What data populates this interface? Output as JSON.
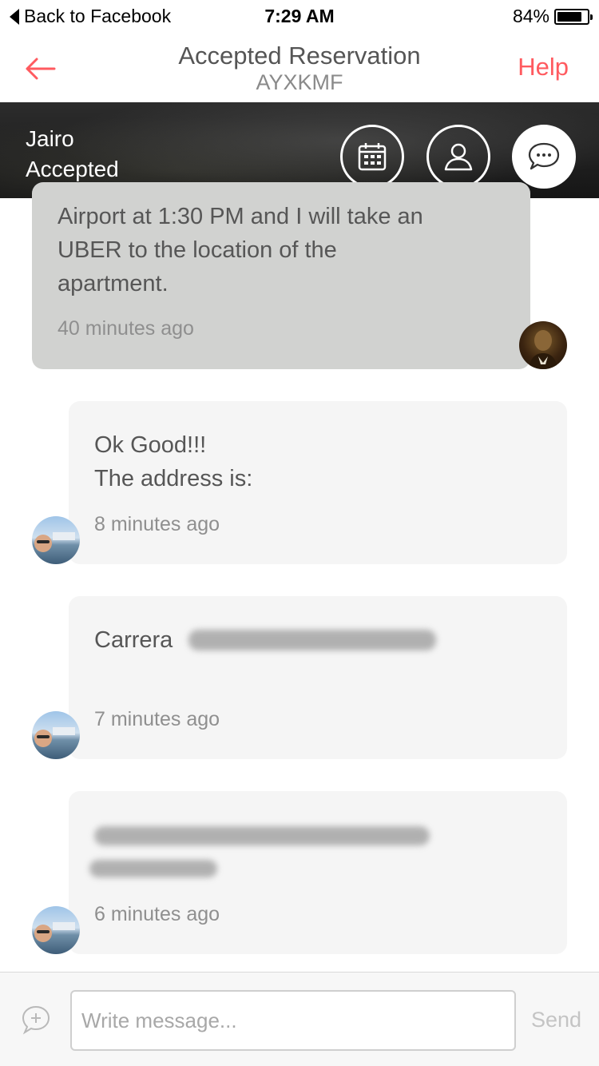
{
  "status_bar": {
    "back_label": "Back to Facebook",
    "time": "7:29 AM",
    "battery_text": "84%",
    "battery_level": 0.84
  },
  "nav": {
    "title": "Accepted Reservation",
    "code": "AYXKMF",
    "help": "Help"
  },
  "banner": {
    "guest_name": "Jairo",
    "status": "Accepted",
    "buttons": [
      "calendar-icon",
      "profile-icon",
      "chat-icon"
    ]
  },
  "messages": [
    {
      "sender": "host",
      "lines": [
        "Airport at 1:30 PM and I will take an",
        "UBER to the location of the",
        "apartment."
      ],
      "time": "40 minutes ago"
    },
    {
      "sender": "guest",
      "lines": [
        "Ok Good!!!",
        "The address is:"
      ],
      "time": "8 minutes ago"
    },
    {
      "sender": "guest",
      "lines": [
        "Carrera"
      ],
      "time": "7 minutes ago"
    },
    {
      "sender": "guest",
      "lines": [],
      "time": "6 minutes ago"
    }
  ],
  "composer": {
    "placeholder": "Write message...",
    "send": "Send"
  },
  "colors": {
    "accent": "#ff5a5f",
    "host_bubble": "#d1d2d0",
    "guest_bubble": "#f5f5f5"
  }
}
